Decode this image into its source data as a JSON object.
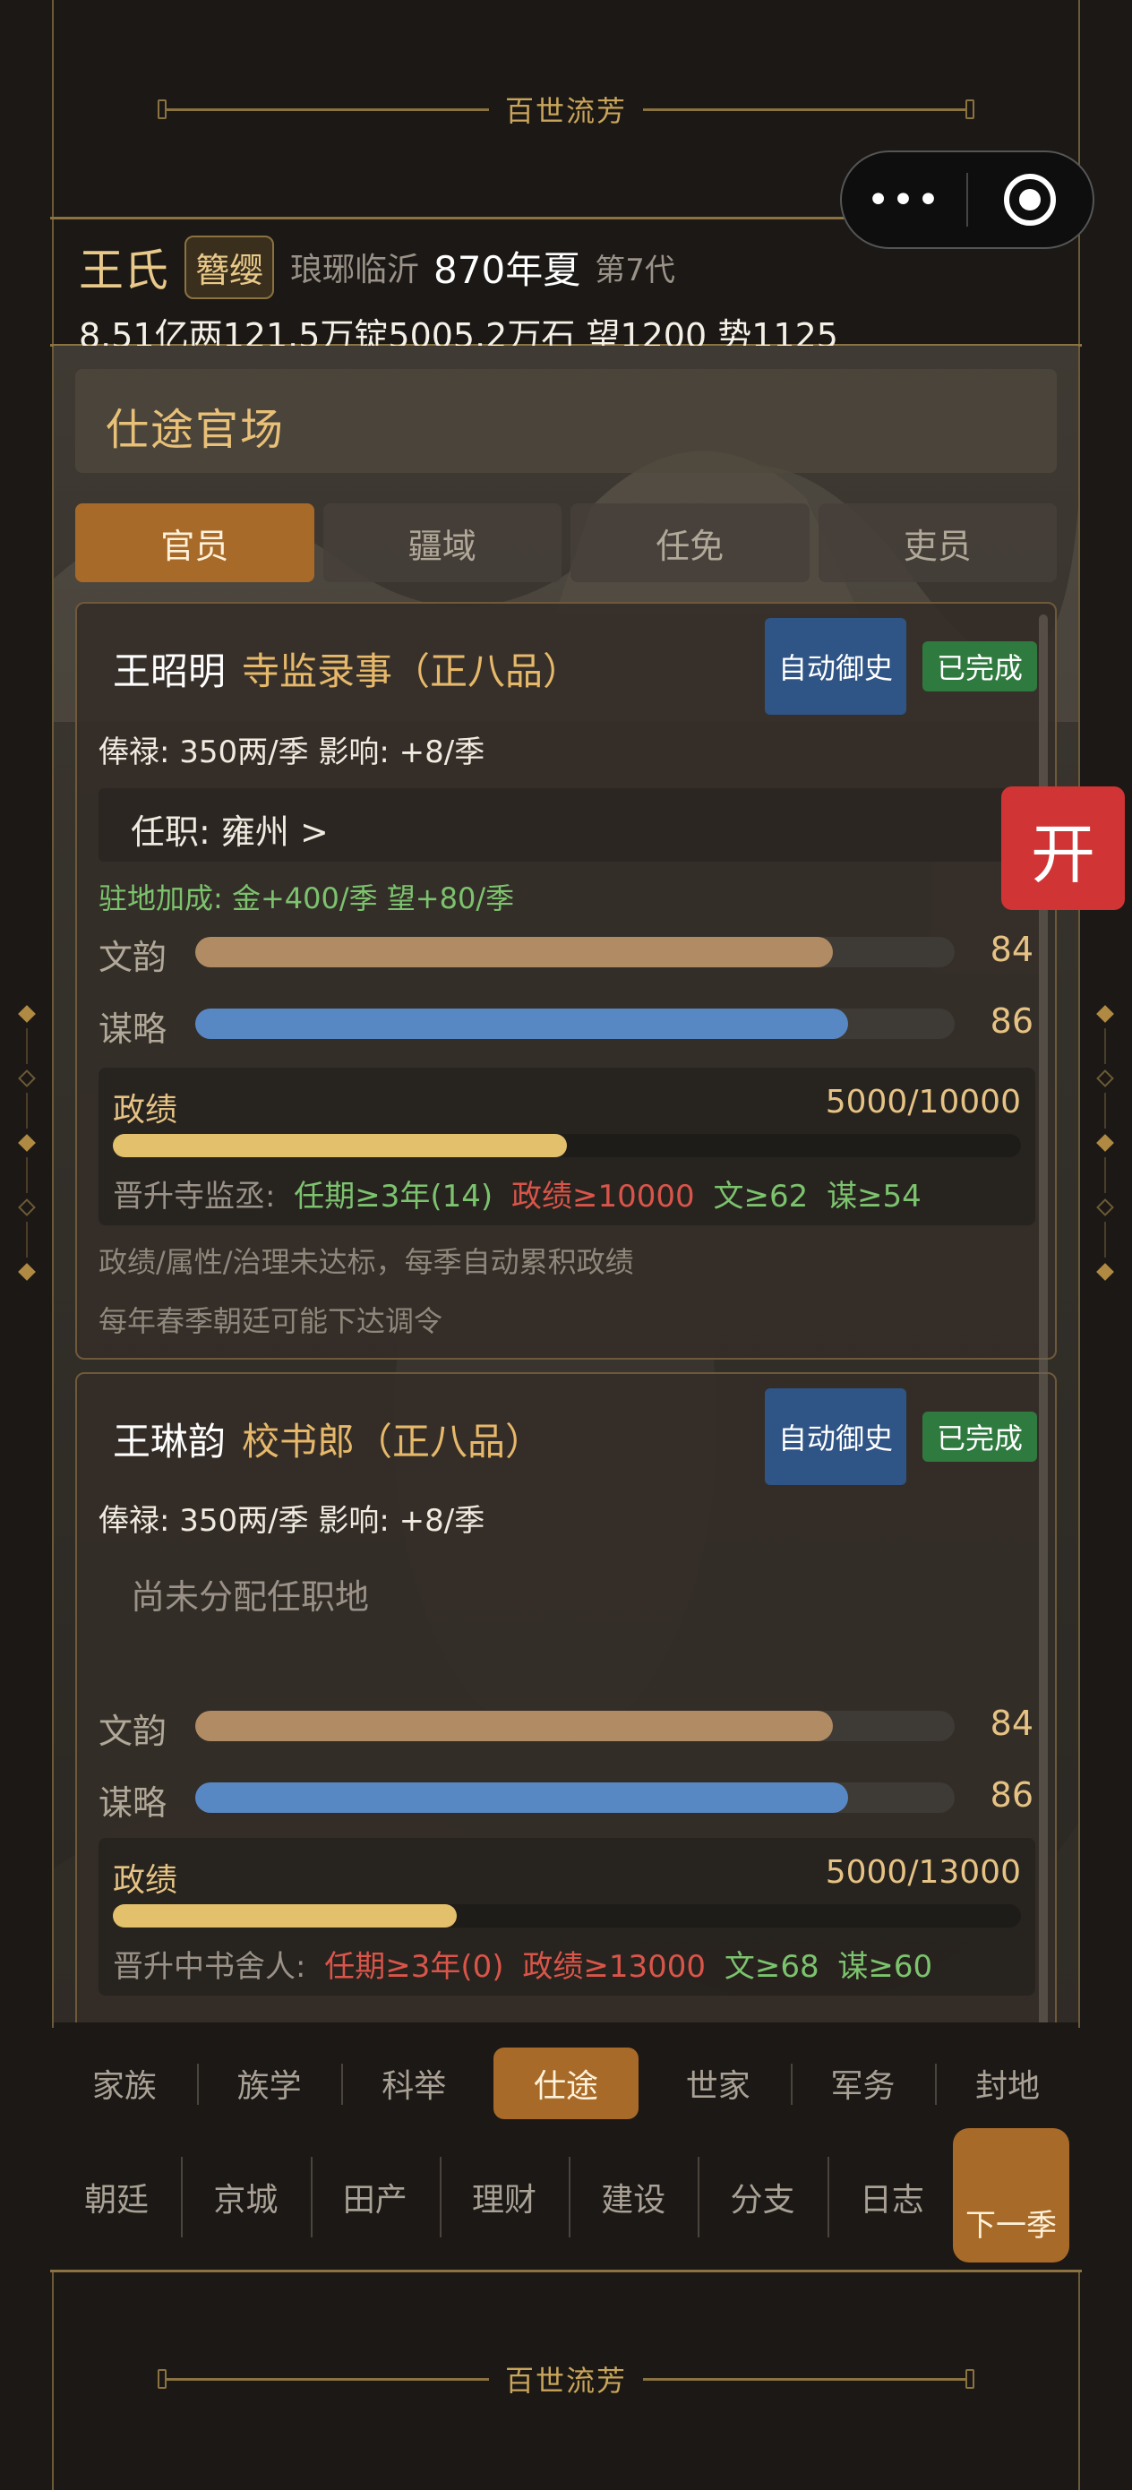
{
  "app_title": "百世流芳",
  "footer_title": "百世流芳",
  "capsule": {
    "more_icon": "•••",
    "close_icon": "target-icon"
  },
  "family": {
    "name": "王氏",
    "rank": "簪缨",
    "place": "琅琊临沂",
    "year": "870年夏",
    "generation": "第7代",
    "resources": "8.51亿两121.5万锭5005.2万石  望1200 势1125"
  },
  "page_title": "仕途官场",
  "tabs": [
    {
      "label": "官员",
      "active": true
    },
    {
      "label": "疆域",
      "active": false
    },
    {
      "label": "任免",
      "active": false
    },
    {
      "label": "吏员",
      "active": false
    }
  ],
  "officials": [
    {
      "name": "王昭明",
      "title": "寺监录事（正八品）",
      "auto_button": "自动御史",
      "status": "已完成",
      "salary": "俸禄: 350两/季   影响: +8/季",
      "post": "任职: 雍州  >",
      "bonus": "驻地加成: 金+400/季  望+80/季",
      "attrs": [
        {
          "label": "文韵",
          "value": "84",
          "percent": 84,
          "color": "#b08b64"
        },
        {
          "label": "谋略",
          "value": "86",
          "percent": 86,
          "color": "#5888c4"
        }
      ],
      "merit": {
        "label": "政绩",
        "value": "5000/10000",
        "fraction": 0.5
      },
      "promotion": {
        "label": "晋升寺监丞:",
        "reqs": [
          {
            "text": "任期≥3年(14)",
            "ok": true
          },
          {
            "text": "政绩≥10000",
            "ok": false
          },
          {
            "text": "文≥62",
            "ok": true
          },
          {
            "text": "谋≥54",
            "ok": true
          }
        ]
      },
      "notes": [
        "政绩/属性/治理未达标，每季自动累积政绩",
        "每年春季朝廷可能下达调令"
      ]
    },
    {
      "name": "王琳韵",
      "title": "校书郎（正八品）",
      "auto_button": "自动御史",
      "status": "已完成",
      "salary": "俸禄: 350两/季   影响: +8/季",
      "post": "尚未分配任职地",
      "attrs": [
        {
          "label": "文韵",
          "value": "84",
          "percent": 84,
          "color": "#b08b64"
        },
        {
          "label": "谋略",
          "value": "86",
          "percent": 86,
          "color": "#5888c4"
        }
      ],
      "merit": {
        "label": "政绩",
        "value": "5000/13000",
        "fraction": 0.385
      },
      "promotion": {
        "label": "晋升中书舍人:",
        "reqs": [
          {
            "text": "任期≥3年(0)",
            "ok": false
          },
          {
            "text": "政绩≥13000",
            "ok": false
          },
          {
            "text": "文≥68",
            "ok": true
          },
          {
            "text": "谋≥60",
            "ok": true
          }
        ]
      }
    }
  ],
  "open_tab": "开",
  "nav_primary": [
    {
      "label": "家族",
      "active": false
    },
    {
      "label": "族学",
      "active": false
    },
    {
      "label": "科举",
      "active": false
    },
    {
      "label": "仕途",
      "active": true
    },
    {
      "label": "世家",
      "active": false
    },
    {
      "label": "军务",
      "active": false
    },
    {
      "label": "封地",
      "active": false
    }
  ],
  "nav_secondary": [
    "朝廷",
    "京城",
    "田产",
    "理财",
    "建设",
    "分支",
    "日志"
  ],
  "next_season": "下一季"
}
